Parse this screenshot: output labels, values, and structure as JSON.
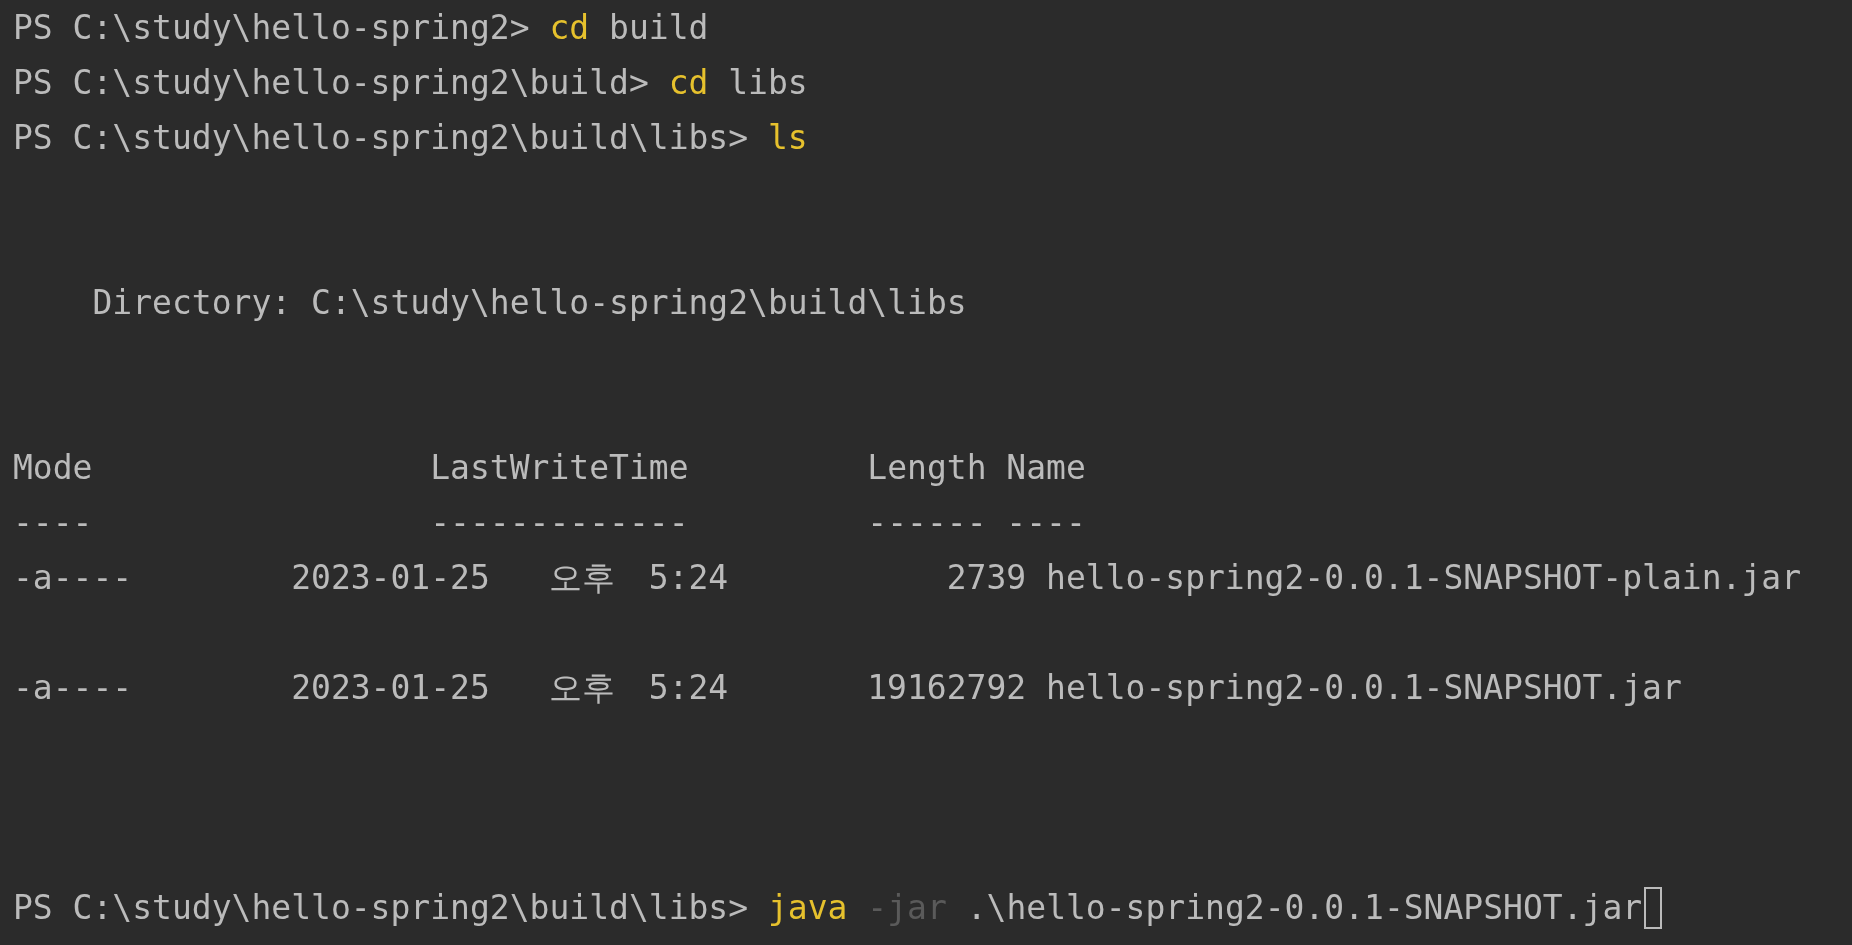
{
  "commands": [
    {
      "prompt": "PS C:\\study\\hello-spring2>",
      "command": "cd",
      "args": [
        {
          "text": "build",
          "kind": "arg"
        }
      ]
    },
    {
      "prompt": "PS C:\\study\\hello-spring2\\build>",
      "command": "cd",
      "args": [
        {
          "text": "libs",
          "kind": "arg"
        }
      ]
    },
    {
      "prompt": "PS C:\\study\\hello-spring2\\build\\libs>",
      "command": "ls"
    }
  ],
  "listing": {
    "directory_label": "Directory:",
    "directory": "C:\\study\\hello-spring2\\build\\libs",
    "columns": [
      "Mode",
      "LastWriteTime",
      "Length",
      "Name"
    ],
    "rules": [
      "----",
      "-------------",
      "------",
      "----"
    ],
    "rows": [
      {
        "mode": "-a----",
        "date": "2023-01-25",
        "meridiem": "오후",
        "time": "5:24",
        "length": "2739",
        "name": "hello-spring2-0.0.1-SNAPSHOT-plain.jar"
      },
      {
        "mode": "-a----",
        "date": "2023-01-25",
        "meridiem": "오후",
        "time": "5:24",
        "length": "19162792",
        "name": "hello-spring2-0.0.1-SNAPSHOT.jar"
      }
    ]
  },
  "current": {
    "prompt": "PS C:\\study\\hello-spring2\\build\\libs>",
    "command": "java",
    "args": [
      {
        "text": "-jar",
        "kind": "param"
      },
      {
        "text": ".\\hello-spring2-0.0.1-SNAPSHOT.jar",
        "kind": "arg"
      }
    ]
  }
}
